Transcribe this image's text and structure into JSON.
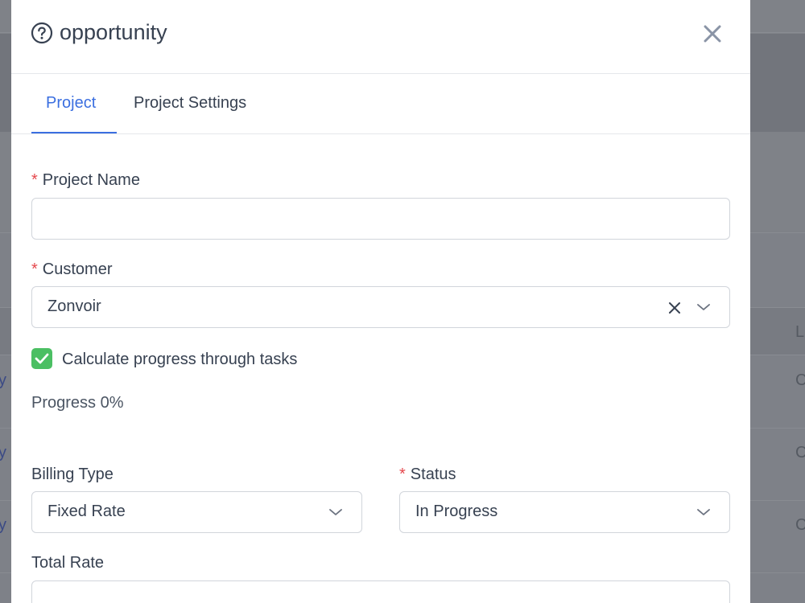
{
  "modal": {
    "title": "opportunity",
    "tabs": [
      {
        "label": "Project",
        "active": true
      },
      {
        "label": "Project Settings",
        "active": false
      }
    ]
  },
  "form": {
    "project_name": {
      "label": "Project Name",
      "required": true,
      "value": ""
    },
    "customer": {
      "label": "Customer",
      "required": true,
      "value": "Zonvoir"
    },
    "calculate_progress": {
      "label": "Calculate progress through tasks",
      "checked": true
    },
    "progress": {
      "label": "Progress 0%",
      "value": 0
    },
    "billing_type": {
      "label": "Billing Type",
      "value": "Fixed Rate"
    },
    "status": {
      "label": "Status",
      "required": true,
      "value": "In Progress"
    },
    "total_rate": {
      "label": "Total Rate",
      "value": ""
    }
  },
  "required_marker": "*",
  "background": {
    "left_fragments": [
      "y",
      "y",
      "y"
    ],
    "right_fragments": [
      "L",
      "C",
      "C",
      "C"
    ]
  },
  "colors": {
    "accent": "#3b6fe0",
    "required": "#e5484d",
    "checkbox": "#4bbf63",
    "overlay": "#7e8188"
  },
  "icons": {
    "help": "question-circle-icon",
    "close": "close-icon",
    "clear": "clear-icon",
    "dropdown": "chevron-down-icon",
    "check": "check-icon"
  }
}
